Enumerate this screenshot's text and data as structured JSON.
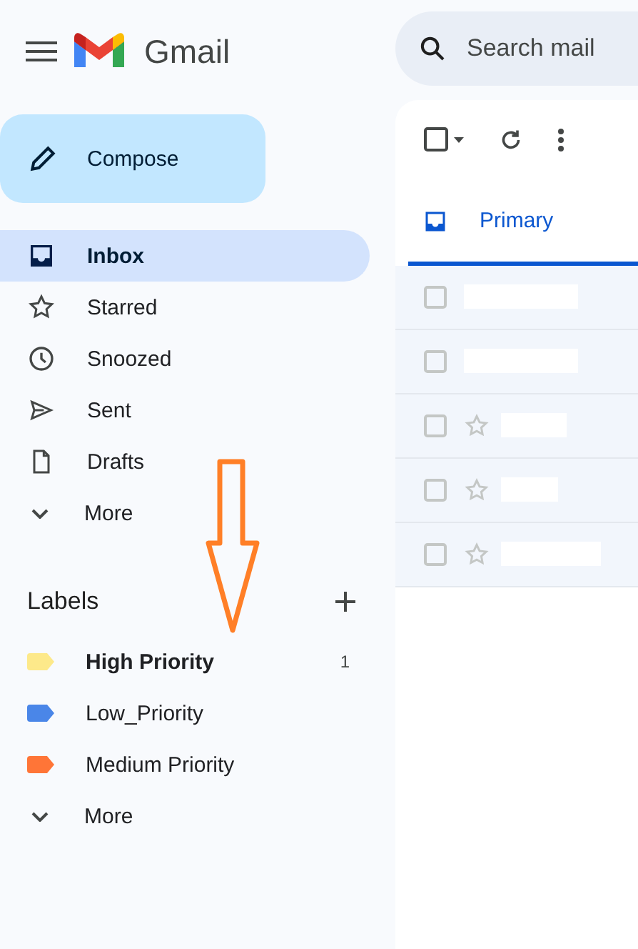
{
  "header": {
    "app_name": "Gmail",
    "search": {
      "placeholder": "Search mail"
    }
  },
  "compose": {
    "label": "Compose"
  },
  "nav": [
    {
      "label": "Inbox",
      "selected": true
    },
    {
      "label": "Starred",
      "selected": false
    },
    {
      "label": "Snoozed",
      "selected": false
    },
    {
      "label": "Sent",
      "selected": false
    },
    {
      "label": "Drafts",
      "selected": false
    },
    {
      "label": "More",
      "selected": false
    }
  ],
  "labels": {
    "title": "Labels",
    "items": [
      {
        "label": "High Priority",
        "color": "#fde98a",
        "count": "1",
        "unread": true
      },
      {
        "label": "Low_Priority",
        "color": "#4a86e8",
        "unread": false
      },
      {
        "label": "Medium Priority",
        "color": "#ff7537",
        "unread": false
      }
    ],
    "more": "More"
  },
  "select_all": {
    "checked": false
  },
  "tabs": [
    {
      "label": "Primary",
      "selected": true
    }
  ],
  "emails": [
    {
      "kind": "covered",
      "checked": false
    },
    {
      "kind": "covered",
      "checked": false
    },
    {
      "kind": "plain",
      "checked": false
    },
    {
      "kind": "plain",
      "checked": false
    },
    {
      "kind": "plain",
      "checked": false
    }
  ]
}
